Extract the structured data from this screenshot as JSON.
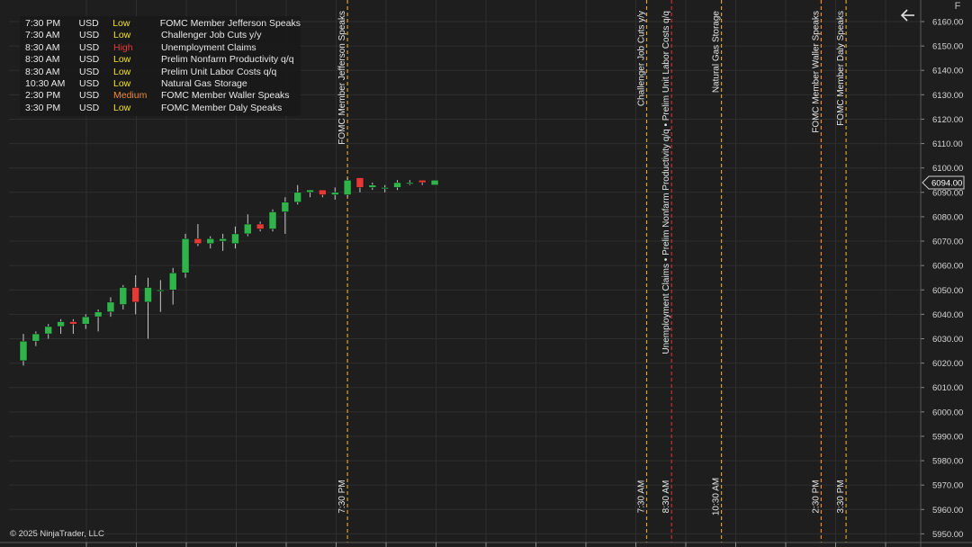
{
  "colors": {
    "background": "#1e1e1e",
    "grid": "#2e2e2e",
    "bull": "#2fb34a",
    "bear": "#e53935",
    "wick": "#c8c8c8",
    "low": "#f2e12f",
    "medium": "#f08a2c",
    "high": "#e53935",
    "event_line_low": "#e0a020",
    "event_line_medium": "#f08a2c",
    "event_line_high": "#d62a2a",
    "price_badge_bg": "#1e1e1e"
  },
  "events_panel": {
    "rows": [
      {
        "time": "7:30 PM",
        "currency": "USD",
        "impact": "Low",
        "name": "FOMC Member Jefferson Speaks"
      },
      {
        "time": "7:30 AM",
        "currency": "USD",
        "impact": "Low",
        "name": "Challenger Job Cuts y/y"
      },
      {
        "time": "8:30 AM",
        "currency": "USD",
        "impact": "High",
        "name": "Unemployment Claims"
      },
      {
        "time": "8:30 AM",
        "currency": "USD",
        "impact": "Low",
        "name": "Prelim Nonfarm Productivity q/q"
      },
      {
        "time": "8:30 AM",
        "currency": "USD",
        "impact": "Low",
        "name": "Prelim Unit Labor Costs q/q"
      },
      {
        "time": "10:30 AM",
        "currency": "USD",
        "impact": "Low",
        "name": "Natural Gas Storage"
      },
      {
        "time": "2:30 PM",
        "currency": "USD",
        "impact": "Medium",
        "name": "FOMC Member Waller Speaks"
      },
      {
        "time": "3:30 PM",
        "currency": "USD",
        "impact": "Low",
        "name": "FOMC Member Daly Speaks"
      }
    ]
  },
  "copyright": "© 2025 NinjaTrader, LLC",
  "toolbar": {
    "back_icon": "arrow-left-icon",
    "f_label": "F"
  },
  "chart_data": {
    "type": "candlestick",
    "y_axis": {
      "ticks": [
        6160,
        6150,
        6140,
        6130,
        6120,
        6110,
        6100,
        6090,
        6080,
        6070,
        6060,
        6050,
        6040,
        6030,
        6020,
        6010,
        6000,
        5990,
        5980,
        5970,
        5960,
        5950
      ],
      "tick_labels": [
        "6160.00",
        "6150.00",
        "6140.00",
        "6130.00",
        "6120.00",
        "6110.00",
        "6100.00",
        "6090.00",
        "6080.00",
        "6070.00",
        "6060.00",
        "6050.00",
        "6040.00",
        "6030.00",
        "6020.00",
        "6010.00",
        "6000.00",
        "5990.00",
        "5980.00",
        "5970.00",
        "5960.00",
        "5950.00"
      ],
      "ylim": [
        5947,
        6163
      ]
    },
    "grid": true,
    "last_price_label": "6094.00",
    "last_price": 6094,
    "candles": [
      {
        "o": 6021,
        "h": 6032,
        "l": 6019,
        "c": 6029
      },
      {
        "o": 6029,
        "h": 6033,
        "l": 6027,
        "c": 6032
      },
      {
        "o": 6032,
        "h": 6036,
        "l": 6030,
        "c": 6035
      },
      {
        "o": 6035,
        "h": 6038,
        "l": 6032,
        "c": 6037
      },
      {
        "o": 6037,
        "h": 6038,
        "l": 6032,
        "c": 6036
      },
      {
        "o": 6036,
        "h": 6040,
        "l": 6034,
        "c": 6039
      },
      {
        "o": 6039,
        "h": 6042,
        "l": 6033,
        "c": 6041
      },
      {
        "o": 6041,
        "h": 6047,
        "l": 6039,
        "c": 6045
      },
      {
        "o": 6044,
        "h": 6052,
        "l": 6042,
        "c": 6051
      },
      {
        "o": 6051,
        "h": 6056,
        "l": 6040,
        "c": 6045
      },
      {
        "o": 6045,
        "h": 6055,
        "l": 6030,
        "c": 6051
      },
      {
        "o": 6050,
        "h": 6054,
        "l": 6041,
        "c": 6050
      },
      {
        "o": 6050,
        "h": 6059,
        "l": 6044,
        "c": 6057
      },
      {
        "o": 6057,
        "h": 6073,
        "l": 6055,
        "c": 6071
      },
      {
        "o": 6071,
        "h": 6077,
        "l": 6068,
        "c": 6069
      },
      {
        "o": 6069,
        "h": 6072,
        "l": 6067,
        "c": 6071
      },
      {
        "o": 6070,
        "h": 6073,
        "l": 6066,
        "c": 6071
      },
      {
        "o": 6069,
        "h": 6076,
        "l": 6067,
        "c": 6073
      },
      {
        "o": 6073,
        "h": 6081,
        "l": 6072,
        "c": 6077
      },
      {
        "o": 6077,
        "h": 6078,
        "l": 6074,
        "c": 6075
      },
      {
        "o": 6075,
        "h": 6083,
        "l": 6074,
        "c": 6082
      },
      {
        "o": 6082,
        "h": 6088,
        "l": 6073,
        "c": 6086
      },
      {
        "o": 6086,
        "h": 6093,
        "l": 6085,
        "c": 6090
      },
      {
        "o": 6090,
        "h": 6091,
        "l": 6088,
        "c": 6091
      },
      {
        "o": 6091,
        "h": 6091,
        "l": 6088,
        "c": 6089
      },
      {
        "o": 6089,
        "h": 6092,
        "l": 6087,
        "c": 6090
      },
      {
        "o": 6089,
        "h": 6096,
        "l": 6088,
        "c": 6095
      },
      {
        "o": 6096,
        "h": 6096,
        "l": 6090,
        "c": 6092
      },
      {
        "o": 6092,
        "h": 6094,
        "l": 6091,
        "c": 6093
      },
      {
        "o": 6092,
        "h": 6093,
        "l": 6090,
        "c": 6092
      },
      {
        "o": 6092,
        "h": 6095,
        "l": 6091,
        "c": 6094
      },
      {
        "o": 6094,
        "h": 6095,
        "l": 6093,
        "c": 6094
      },
      {
        "o": 6095,
        "h": 6095,
        "l": 6093,
        "c": 6094
      },
      {
        "o": 6093,
        "h": 6095,
        "l": 6093,
        "c": 6095
      }
    ],
    "event_markers": [
      {
        "bar": 26,
        "label": "FOMC Member Jefferson Speaks",
        "time": "7:30 PM",
        "impact": "Low"
      },
      {
        "bar": 50,
        "label": "Challenger Job Cuts y/y",
        "time": "7:30 AM",
        "impact": "Low"
      },
      {
        "bar": 52,
        "label": "Unemployment Claims • Prelim Nonfarm Productivity q/q • Prelim Unit Labor Costs q/q",
        "time": "8:30 AM",
        "impact": "High"
      },
      {
        "bar": 56,
        "label": "Natural Gas Storage",
        "time": "10:30 AM",
        "impact": "Low"
      },
      {
        "bar": 64,
        "label": "FOMC Member Waller Speaks",
        "time": "2:30 PM",
        "impact": "Medium"
      },
      {
        "bar": 66,
        "label": "FOMC Member Daly Speaks",
        "time": "3:30 PM",
        "impact": "Low"
      }
    ]
  }
}
